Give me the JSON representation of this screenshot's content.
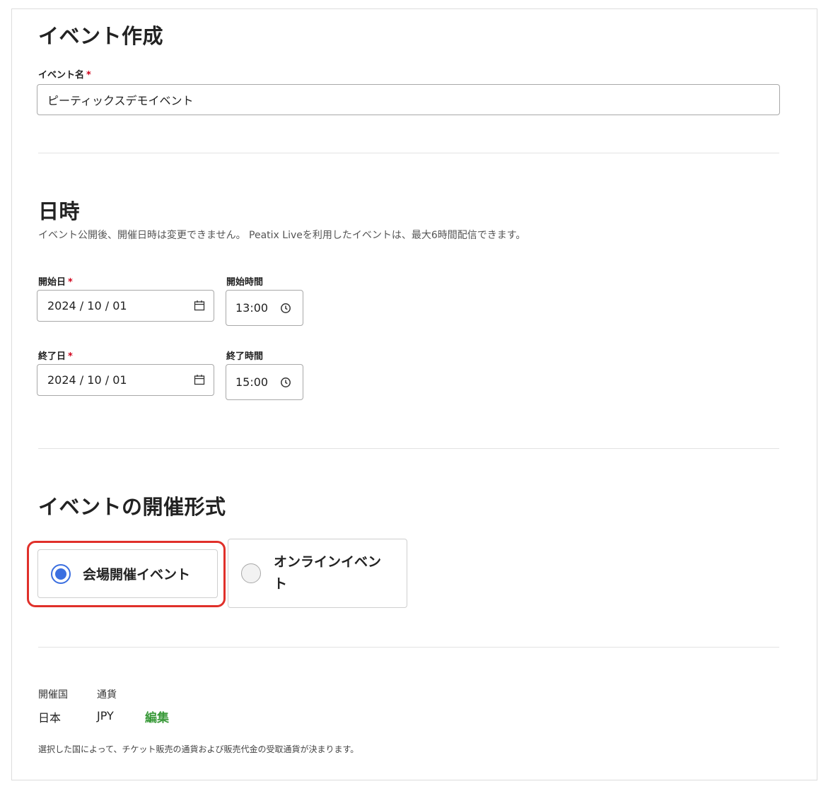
{
  "page": {
    "title": "イベント作成"
  },
  "event_name": {
    "label": "イベント名",
    "required_mark": "*",
    "value": "ピーティックスデモイベント"
  },
  "datetime": {
    "heading": "日時",
    "note": "イベント公開後、開催日時は変更できません。 Peatix Liveを利用したイベントは、最大6時間配信できます。",
    "start_date": {
      "label": "開始日",
      "required_mark": "*",
      "value": "2024 / 10 / 01",
      "icon": "calendar-icon"
    },
    "start_time": {
      "label": "開始時間",
      "value": "13:00",
      "icon": "clock-icon"
    },
    "end_date": {
      "label": "終了日",
      "required_mark": "*",
      "value": "2024 / 10 / 01",
      "icon": "calendar-icon"
    },
    "end_time": {
      "label": "終了時間",
      "value": "15:00",
      "icon": "clock-icon"
    }
  },
  "format": {
    "heading": "イベントの開催形式",
    "options": [
      {
        "label": "会場開催イベント",
        "selected": true
      },
      {
        "label_line1": "オンラインイベン",
        "label_line2": "ト",
        "selected": false
      }
    ]
  },
  "locale": {
    "country_label": "開催国",
    "currency_label": "通貨",
    "country_value": "日本",
    "currency_value": "JPY",
    "edit_label": "編集",
    "note": "選択した国によって、チケット販売の通貨および販売代金の受取通貨が決まります。"
  },
  "colors": {
    "accent_blue": "#3b6fe0",
    "highlight_red": "#e0302a",
    "link_green": "#3a9a3a",
    "required_red": "#d0021b"
  }
}
